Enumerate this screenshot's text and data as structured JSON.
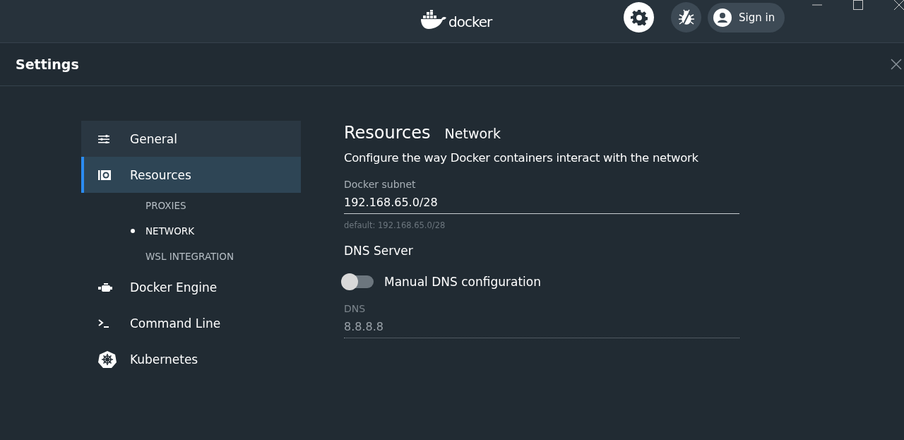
{
  "topbar": {
    "logo_text": "docker",
    "tool_buttons": [
      {
        "kind": "settings",
        "selected": true
      },
      {
        "kind": "bug",
        "selected": false
      }
    ],
    "sign_in": "Sign in"
  },
  "panel": {
    "title": "Settings"
  },
  "sidebar": {
    "items": [
      {
        "label": "General",
        "kind": "general",
        "selected": false
      },
      {
        "label": "Resources",
        "kind": "resources",
        "selected": true,
        "children": [
          {
            "label": "PROXIES",
            "selected": false
          },
          {
            "label": "NETWORK",
            "selected": true
          },
          {
            "label": "WSL INTEGRATION",
            "selected": false
          }
        ]
      },
      {
        "label": "Docker Engine",
        "kind": "engine",
        "selected": false
      },
      {
        "label": "Command Line",
        "kind": "cli",
        "selected": false
      },
      {
        "label": "Kubernetes",
        "kind": "kubernetes",
        "selected": false
      }
    ]
  },
  "content": {
    "title": "Resources",
    "subtitle": "Network",
    "description": "Configure the way Docker containers interact with the network",
    "subnet": {
      "label": "Docker subnet",
      "value": "192.168.65.0/28",
      "hint": "default: 192.168.65.0/28",
      "disabled": false
    },
    "dns_heading": "DNS Server",
    "toggle": {
      "label": "Manual DNS configuration",
      "on": false
    },
    "dns": {
      "label": "DNS",
      "value": "8.8.8.8",
      "disabled": true
    }
  }
}
